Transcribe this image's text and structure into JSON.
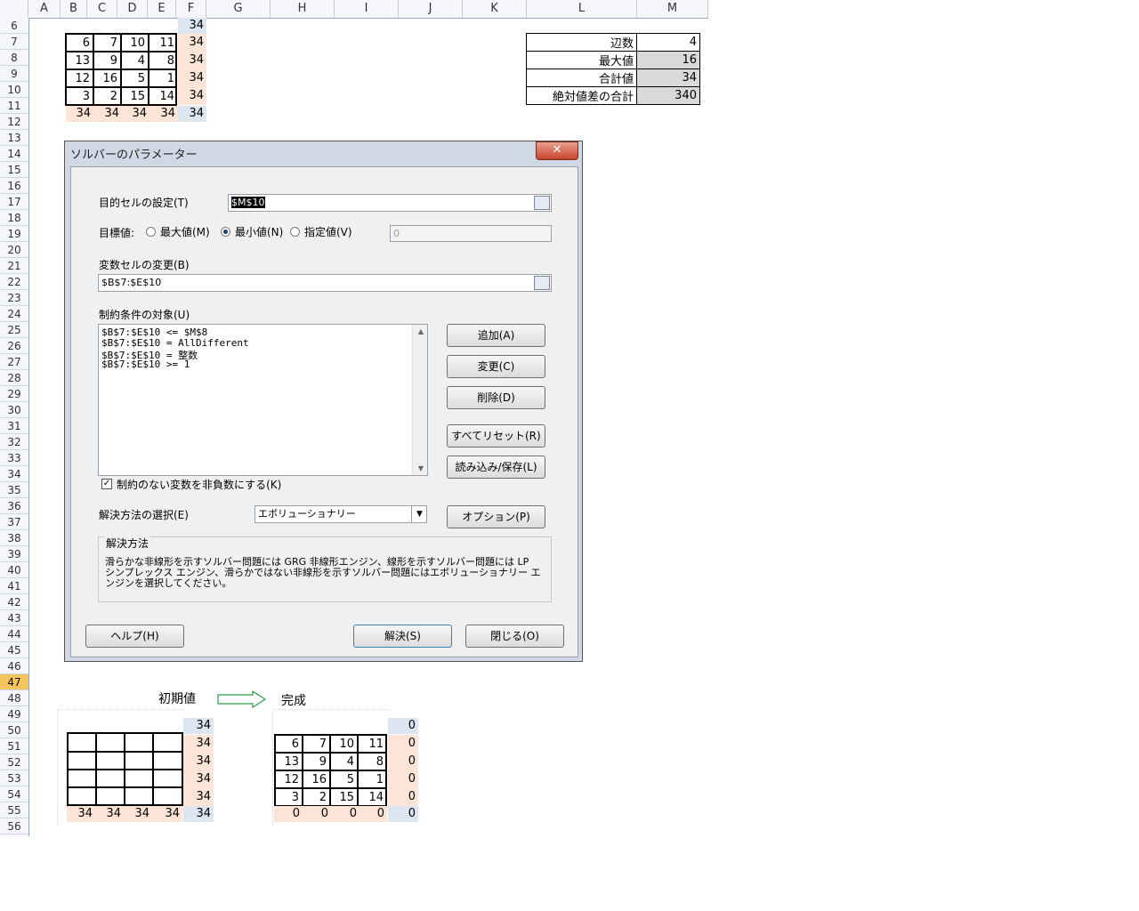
{
  "columns": [
    "A",
    "B",
    "C",
    "D",
    "E",
    "F",
    "G",
    "H",
    "I",
    "J",
    "K",
    "L",
    "M"
  ],
  "rows": [
    "6",
    "7",
    "8",
    "9",
    "10",
    "11",
    "12",
    "13",
    "14",
    "15",
    "16",
    "17",
    "18",
    "19",
    "20",
    "21",
    "22",
    "23",
    "24",
    "25",
    "26",
    "27",
    "28",
    "29",
    "30",
    "31",
    "32",
    "33",
    "34",
    "35",
    "36",
    "37",
    "38",
    "39",
    "40",
    "41",
    "42",
    "43",
    "44",
    "45",
    "46",
    "47",
    "48",
    "49",
    "50",
    "51",
    "52",
    "53",
    "54",
    "55",
    "56"
  ],
  "selected_row": "47",
  "top_grid": {
    "row_sum_header": "34",
    "cells": [
      [
        "6",
        "7",
        "10",
        "11"
      ],
      [
        "13",
        "9",
        "4",
        "8"
      ],
      [
        "12",
        "16",
        "5",
        "1"
      ],
      [
        "3",
        "2",
        "15",
        "14"
      ]
    ],
    "row_sums": [
      "34",
      "34",
      "34",
      "34"
    ],
    "col_sums": [
      "34",
      "34",
      "34",
      "34"
    ],
    "diag_sum": "34"
  },
  "side_table": [
    {
      "label": "辺数",
      "value": "4"
    },
    {
      "label": "最大値",
      "value": "16"
    },
    {
      "label": "合計値",
      "value": "34"
    },
    {
      "label": "絶対値差の合計",
      "value": "340"
    }
  ],
  "dialog": {
    "title": "ソルバーのパラメーター",
    "close": "✕",
    "objective_label": "目的セルの設定(T)",
    "objective_value": "$M$10",
    "to_label": "目標値:",
    "max_label": "最大値(M)",
    "min_label": "最小値(N)",
    "value_of_label": "指定値(V)",
    "value_of_value": "0",
    "changing_label": "変数セルの変更(B)",
    "changing_value": "$B$7:$E$10",
    "constraints_label": "制約条件の対象(U)",
    "constraints": [
      "$B$7:$E$10 <= $M$8",
      "$B$7:$E$10 = AllDifferent",
      "$B$7:$E$10 = 整数",
      "$B$7:$E$10 >= 1"
    ],
    "add": "追加(A)",
    "change": "変更(C)",
    "delete": "削除(D)",
    "reset_all": "すべてリセット(R)",
    "load_save": "読み込み/保存(L)",
    "nonneg_label": "制約のない変数を非負数にする(K)",
    "method_label": "解決方法の選択(E)",
    "method_value": "エボリューショナリー",
    "options": "オプション(P)",
    "group_title": "解決方法",
    "description": "滑らかな非線形を示すソルバー問題には GRG 非線形エンジン、線形を示すソルバー問題には LP シンプレックス エンジン、滑らかではない非線形を示すソルバー問題にはエボリューショナリー エンジンを選択してください。",
    "help": "ヘルプ(H)",
    "solve": "解決(S)",
    "close_btn": "閉じる(O)"
  },
  "bottom": {
    "initial_label": "初期値",
    "done_label": "完成",
    "initial": {
      "top_sum": "34",
      "row_sums": [
        "34",
        "34",
        "34",
        "34"
      ],
      "col_sums": [
        "34",
        "34",
        "34",
        "34"
      ],
      "corner": "34"
    },
    "done": {
      "top_sum": "0",
      "cells": [
        [
          "6",
          "7",
          "10",
          "11"
        ],
        [
          "13",
          "9",
          "4",
          "8"
        ],
        [
          "12",
          "16",
          "5",
          "1"
        ],
        [
          "3",
          "2",
          "15",
          "14"
        ]
      ],
      "row_sums": [
        "0",
        "0",
        "0",
        "0"
      ],
      "col_sums": [
        "0",
        "0",
        "0",
        "0"
      ],
      "corner": "0"
    }
  }
}
